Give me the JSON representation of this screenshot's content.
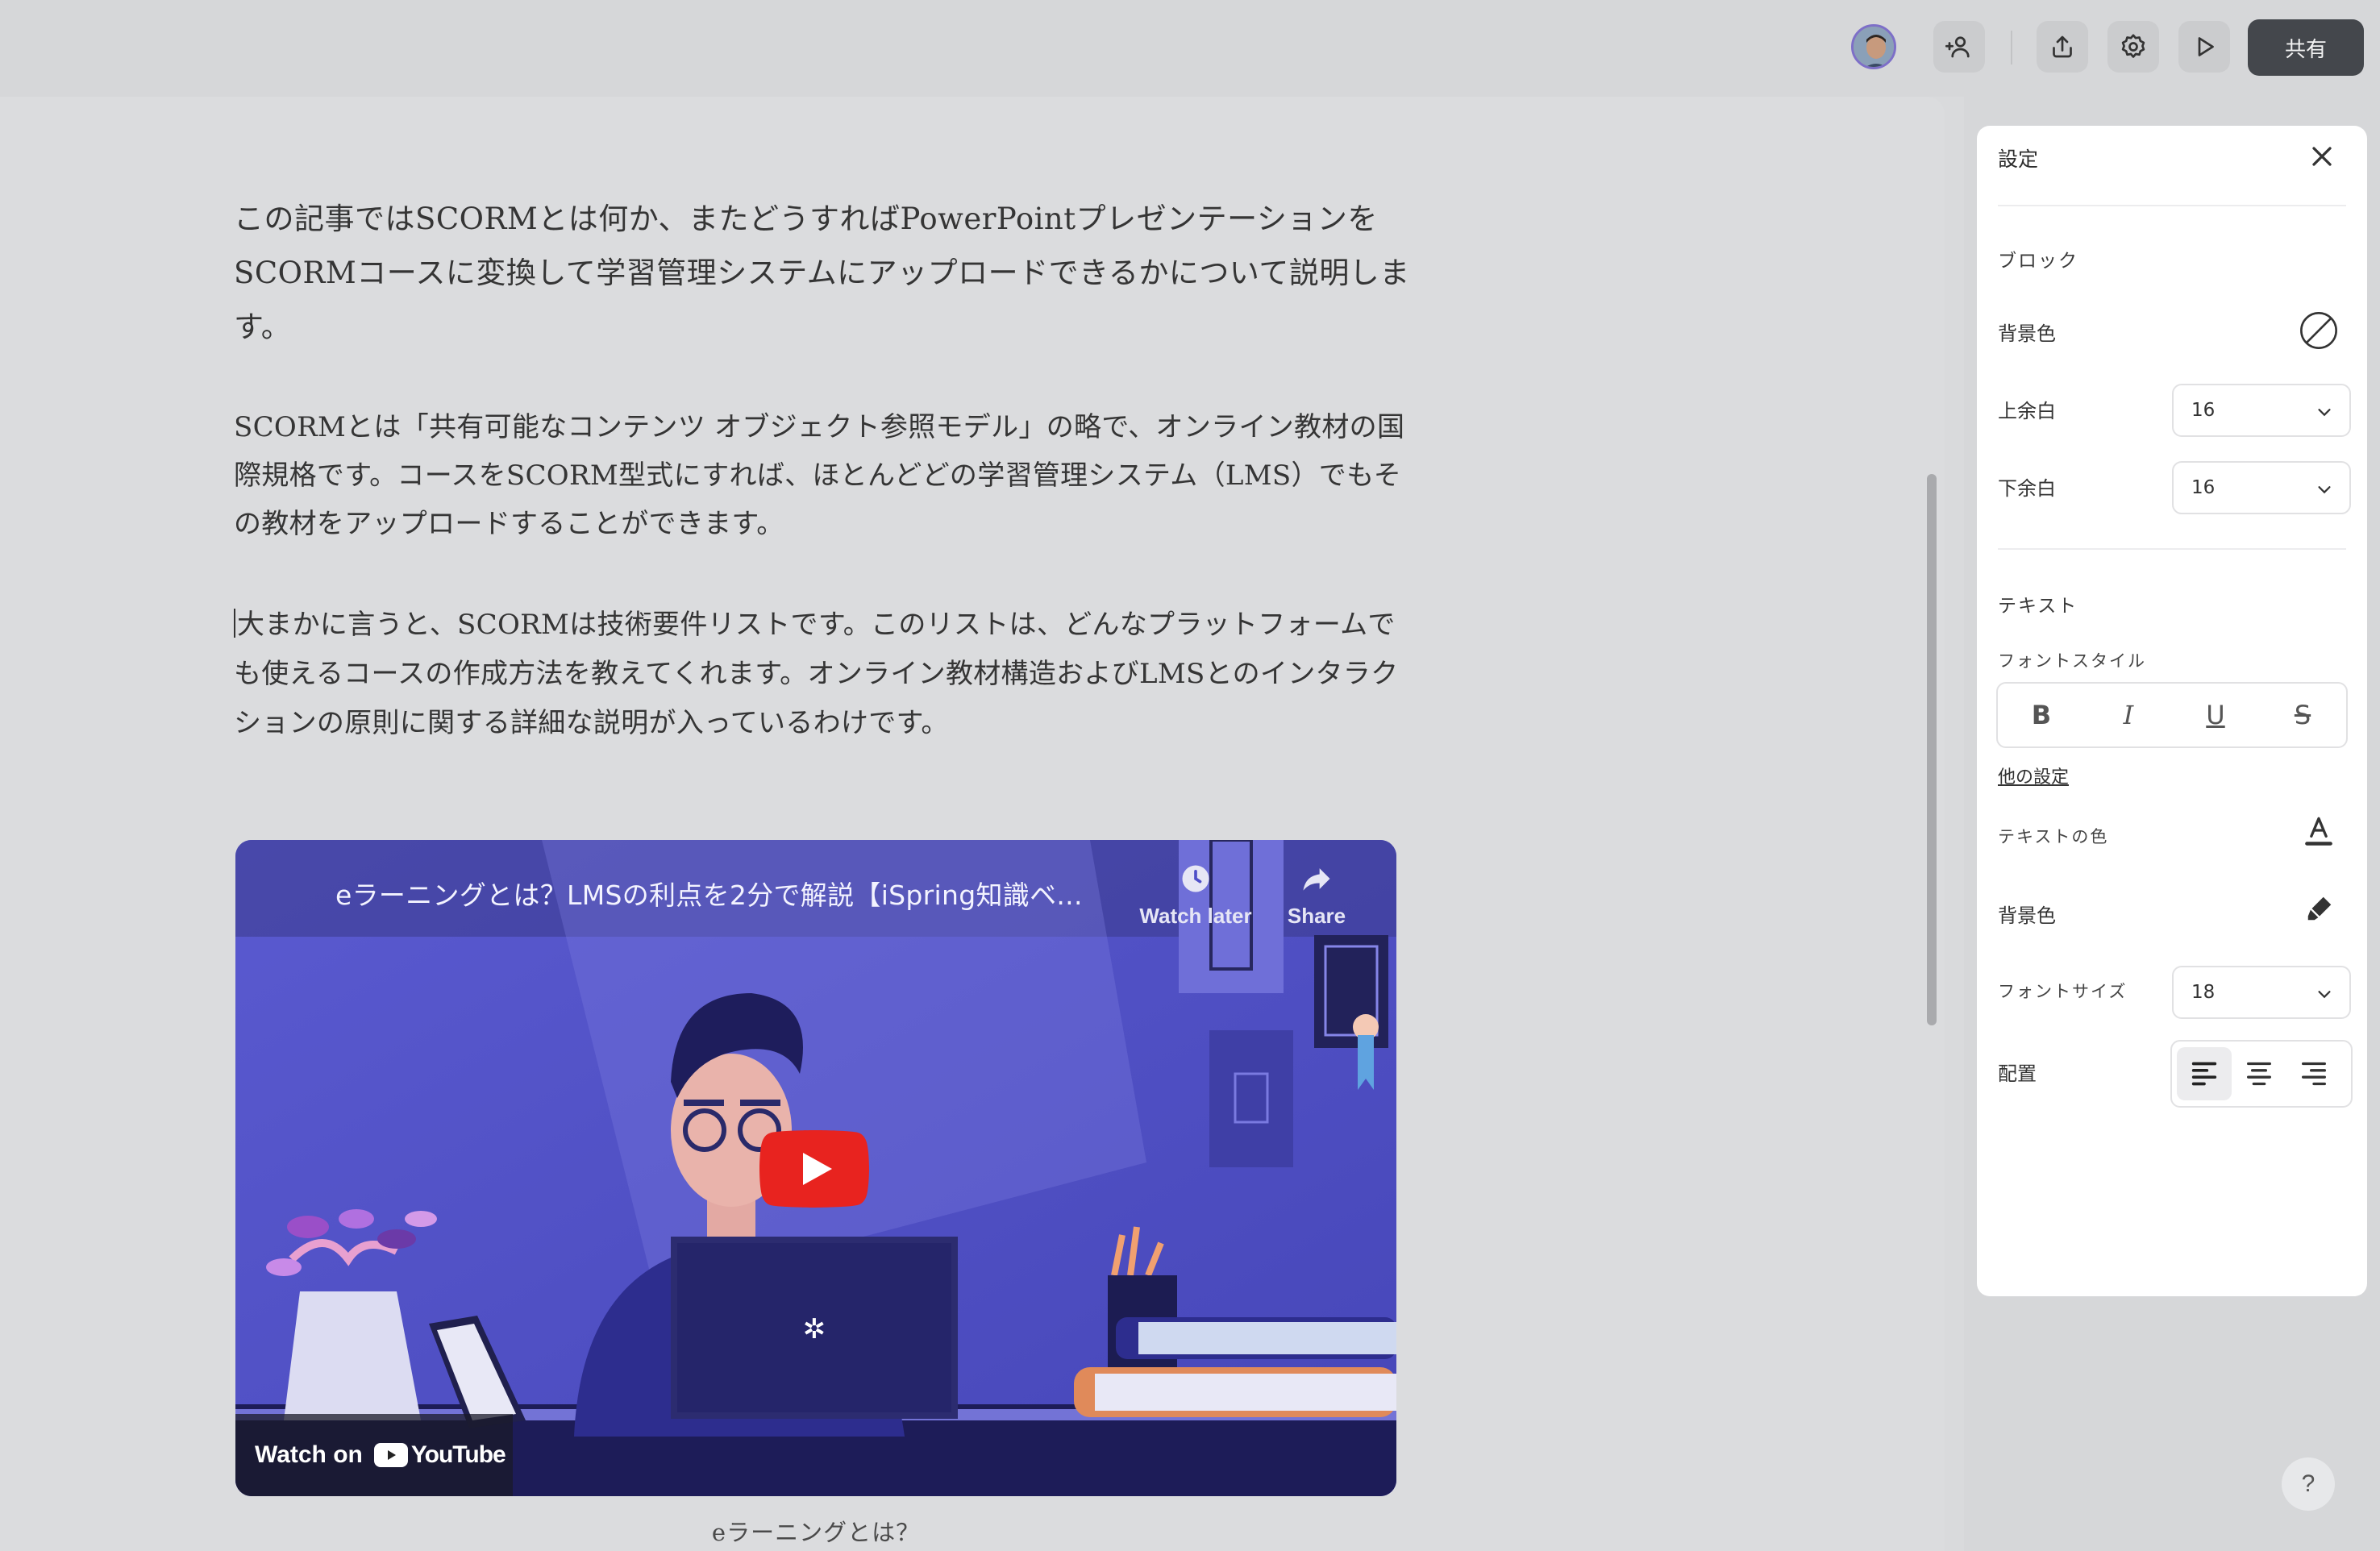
{
  "toolbar": {
    "share_label": "共有",
    "icons": [
      "avatar",
      "add-user-icon",
      "upload-icon",
      "gear-icon",
      "play-icon"
    ]
  },
  "document": {
    "paragraphs": [
      "この記事ではSCORMとは何か、またどうすればPowerPointプレゼンテーションをSCORMコースに変換して学習管理システムにアップロードできるかについて説明します。",
      "SCORMとは「共有可能なコンテンツ オブジェクト参照モデル」の略で、オンライン教材の国際規格です。コースをSCORM型式にすれば、ほとんどどの学習管理システム（LMS）でもその教材をアップロードすることができます。",
      "大まかに言うと、SCORMは技術要件リストです。このリストは、どんなプラットフォームでも使えるコースの作成方法を教えてくれます。オンライン教材構造およびLMSとのインタラクションの原則に関する詳細な説明が入っているわけです。"
    ],
    "video": {
      "title": "eラーニングとは？LMSの利点を2分で解説【iSpring知識ベ...",
      "watch_later": "Watch later",
      "share": "Share",
      "watch_on": "Watch on",
      "youtube": "YouTube",
      "caption": "eラーニングとは？"
    }
  },
  "settings": {
    "title": "設定",
    "block_section": "ブロック",
    "bg_color_label": "背景色",
    "top_margin_label": "上余白",
    "top_margin_value": "16",
    "bottom_margin_label": "下余白",
    "bottom_margin_value": "16",
    "text_section": "テキスト",
    "font_style_label": "フォントスタイル",
    "font_style_buttons": [
      "B",
      "I",
      "U",
      "S"
    ],
    "more_settings": "他の設定",
    "text_color_label": "テキストの色",
    "text_bg_color_label": "背景色",
    "font_size_label": "フォントサイズ",
    "font_size_value": "18",
    "alignment_label": "配置",
    "help": "?"
  },
  "colors": {
    "accent": "#44474c",
    "youtube_red": "#e8231f",
    "video_bg": "#4f4fc8"
  }
}
